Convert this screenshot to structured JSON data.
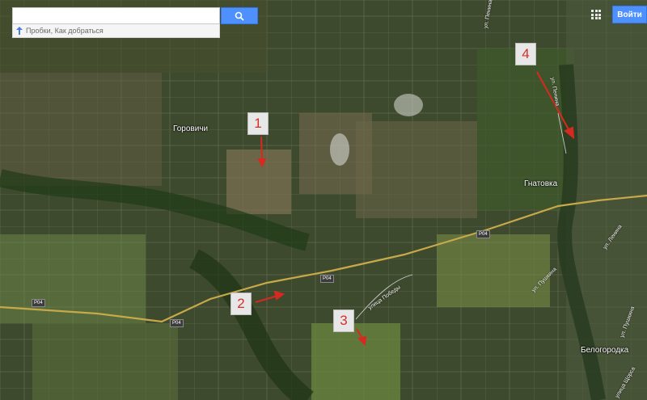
{
  "search": {
    "placeholder": "",
    "sub_text": "Пробки, Как добраться",
    "search_icon": "search-icon",
    "route_icon": "route-icon"
  },
  "header": {
    "apps_icon": "apps-grid-icon",
    "signin_label": "Войти"
  },
  "map": {
    "places": {
      "gorovichi": "Горовичи",
      "gnatovka": "Гнатовка",
      "belogorodka": "Белогородка"
    },
    "roads": {
      "street_1": "ул. Пенина",
      "street_2": "ул. Пенина",
      "street_3": "ул. Ленина",
      "street_4": "улица Победы",
      "street_5": "ул. Пушкина",
      "street_6": "ул. Пушкина",
      "street_7": "улица Щорса"
    },
    "route_shield": "P04",
    "markers": [
      "1",
      "2",
      "3",
      "4"
    ]
  },
  "colors": {
    "marker_text": "#d4302a",
    "arrow": "#d62a20",
    "button_blue": "#4d90fe"
  }
}
